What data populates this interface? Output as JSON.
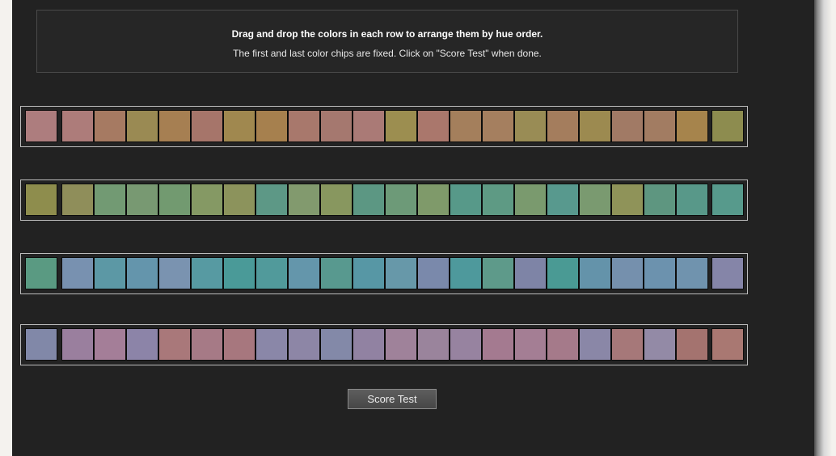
{
  "instructions": {
    "title": "Drag and drop the colors in each row to arrange them by hue order.",
    "subtitle": "The first and last color chips are fixed. Click on \"Score Test\" when done."
  },
  "rows": [
    [
      "#ad7d7e",
      "#ad7c7a",
      "#a67a62",
      "#9a8a53",
      "#a67f52",
      "#a6756a",
      "#a0884f",
      "#a6804e",
      "#a8786c",
      "#a5786f",
      "#aa7a76",
      "#9c8e50",
      "#aa776c",
      "#a47f5c",
      "#a57f5f",
      "#998c55",
      "#a47d5d",
      "#9c8a50",
      "#a17a65",
      "#a27c62",
      "#a6844c",
      "#8d8c4f"
    ],
    [
      "#8e8d4d",
      "#8f8e5a",
      "#729a73",
      "#789972",
      "#729a70",
      "#859964",
      "#8c935c",
      "#5d9886",
      "#829a6e",
      "#88975f",
      "#5c9783",
      "#6d9a78",
      "#7f9a6a",
      "#579989",
      "#5e9a84",
      "#7a9a6e",
      "#58998e",
      "#7a9a70",
      "#8f9359",
      "#5e9680",
      "#589889",
      "#579a8c"
    ],
    [
      "#5a9a82",
      "#7891b0",
      "#5c98a5",
      "#6495ac",
      "#7a93b0",
      "#579aa2",
      "#4a9a98",
      "#519a9b",
      "#6496ab",
      "#58998f",
      "#5797a5",
      "#6798a9",
      "#7a89ab",
      "#4e999c",
      "#5e9a8a",
      "#7e84a6",
      "#4a9a94",
      "#6493aa",
      "#7590ad",
      "#6c92ae",
      "#7093ae",
      "#8585a8"
    ],
    [
      "#8188a8",
      "#9a7f9e",
      "#a47e98",
      "#8c84a8",
      "#a9787a",
      "#a67a86",
      "#a7777e",
      "#8a87a8",
      "#8d86a6",
      "#8389a8",
      "#9182a2",
      "#9f829a",
      "#9a849c",
      "#9783a0",
      "#a47a90",
      "#a47e94",
      "#a57a8a",
      "#8a87a7",
      "#a67879",
      "#938aa6",
      "#a4736f",
      "#a97872"
    ]
  ],
  "button": {
    "score_label": "Score Test"
  }
}
